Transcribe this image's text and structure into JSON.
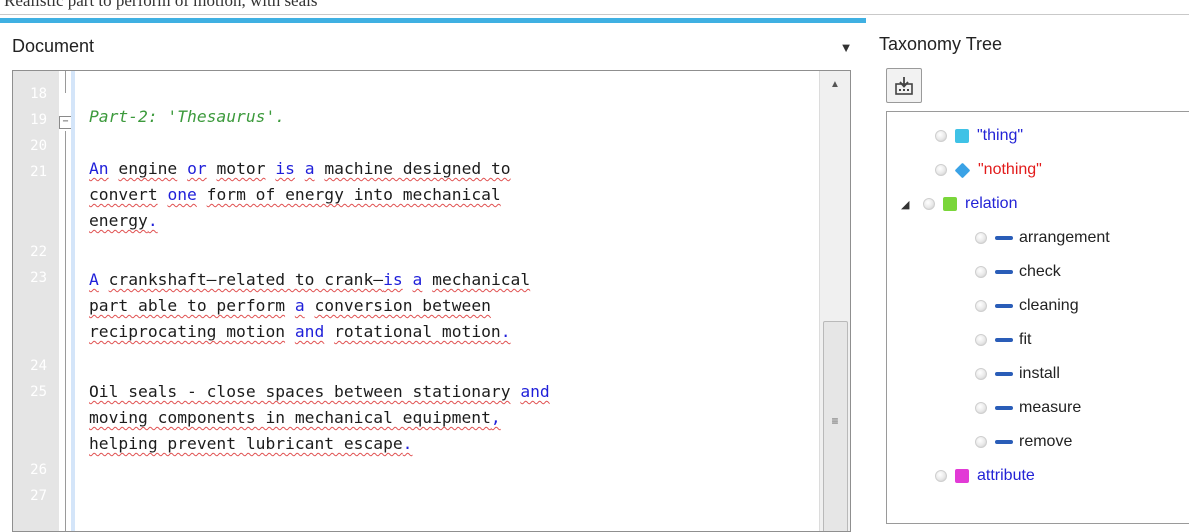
{
  "top_caption": "Realistic part to perform of motion, with seals",
  "document": {
    "title": "Document",
    "line_numbers": [
      "18",
      "19",
      "20",
      "21",
      "22",
      "23",
      "24",
      "25",
      "26",
      "27"
    ],
    "lines": [
      {
        "line": "19",
        "text": "Part-2: 'Thesaurus'."
      },
      {
        "line": "21",
        "text": "An engine or motor is a machine designed to"
      },
      {
        "line": "21-2",
        "text": "convert one form of energy into mechanical"
      },
      {
        "line": "21-3",
        "text": "energy."
      },
      {
        "line": "23",
        "text": "A crankshaft—related to crank—is a mechanical"
      },
      {
        "line": "23-2",
        "text": "part able to perform a conversion between"
      },
      {
        "line": "23-3",
        "text": "reciprocating motion and rotational motion."
      },
      {
        "line": "25",
        "text": "Oil seals - close spaces between stationary and"
      },
      {
        "line": "25-2",
        "text": "moving components in mechanical equipment,"
      },
      {
        "line": "25-3",
        "text": "helping prevent lubricant escape."
      }
    ],
    "keyword_color": "#1f1fd9",
    "comment_color": "#3c9a3c",
    "spell_error_color": "#e05050"
  },
  "taxonomy": {
    "title": "Taxonomy Tree",
    "toolbar_icon": "import-icon",
    "nodes": [
      {
        "label": "\"thing\"",
        "icon": "cube",
        "color": "#3fc2e6",
        "text_color": "#2323d6"
      },
      {
        "label": "\"nothing\"",
        "icon": "diamond",
        "color": "#3aa2e6",
        "text_color": "#e21b1b"
      },
      {
        "label": "relation",
        "icon": "cube",
        "color": "#7ad63a",
        "text_color": "#2323d6",
        "expanded": true,
        "children": [
          "arrangement",
          "check",
          "cleaning",
          "fit",
          "install",
          "measure",
          "remove"
        ]
      },
      {
        "label": "attribute",
        "icon": "cube",
        "color": "#e23ad6",
        "text_color": "#2323d6"
      }
    ],
    "child_dash_color": "#2a5db8"
  }
}
